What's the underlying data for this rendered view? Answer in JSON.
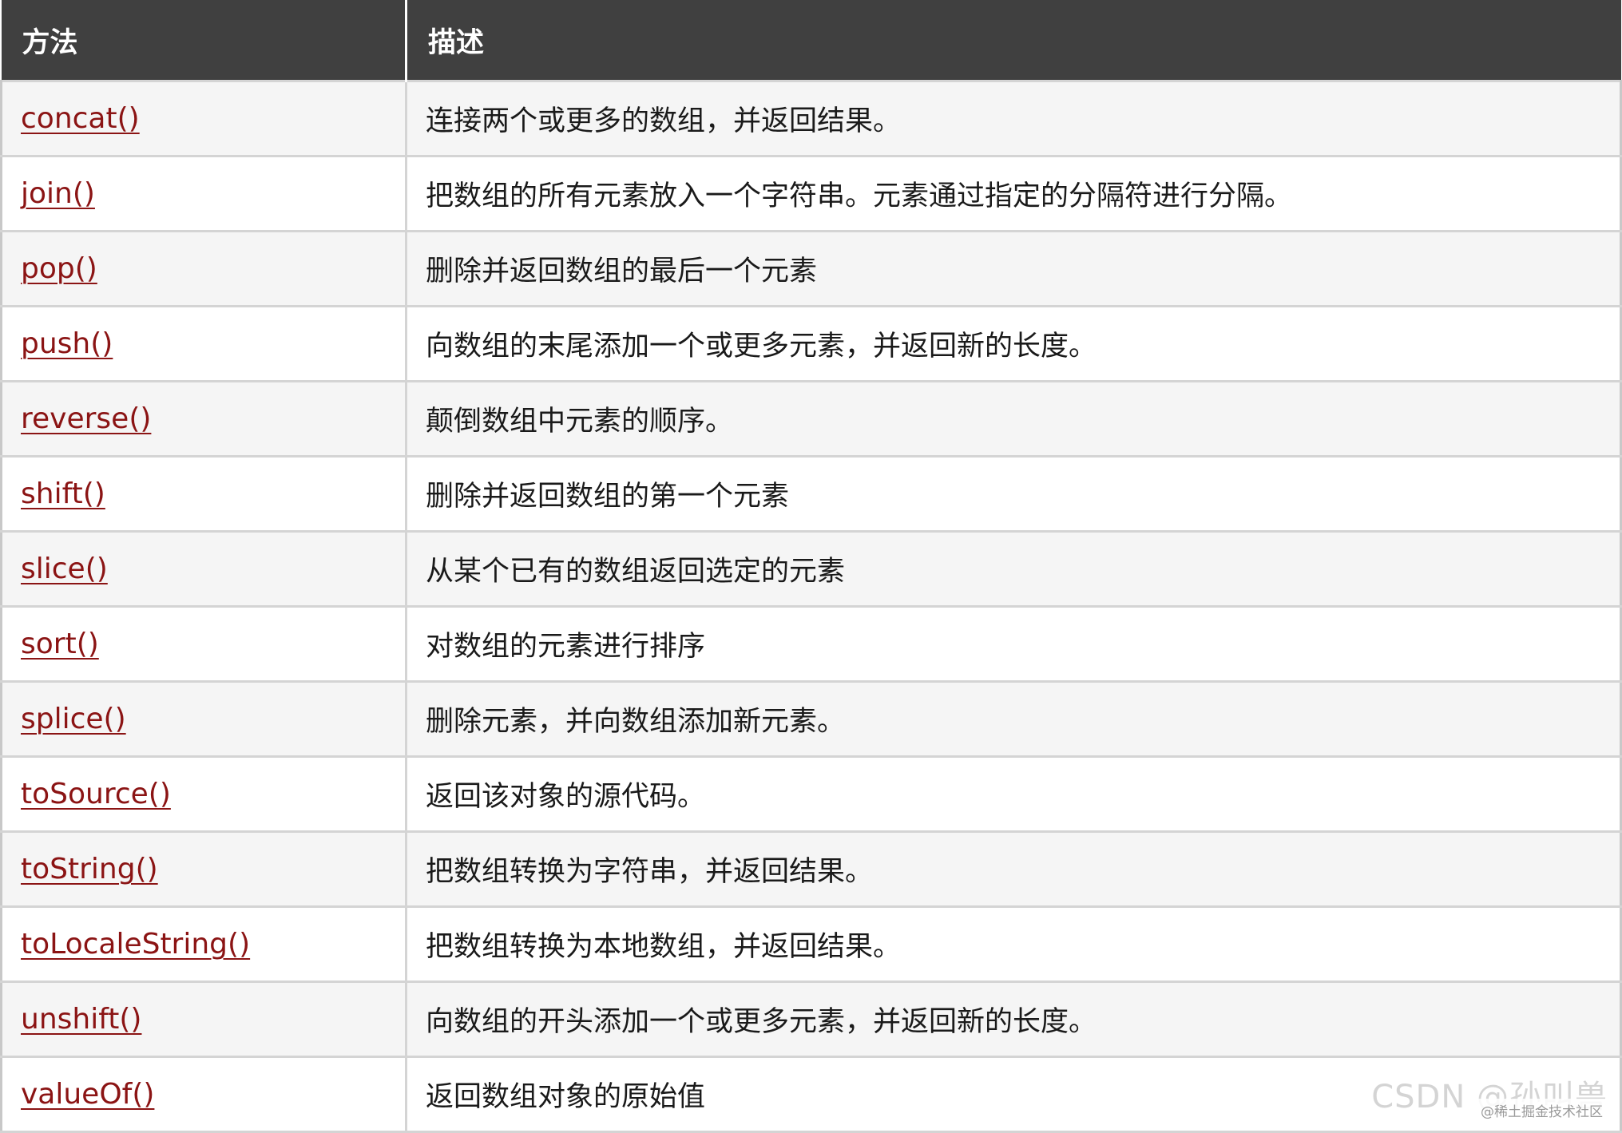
{
  "table": {
    "headers": {
      "method": "方法",
      "description": "描述"
    },
    "rows": [
      {
        "method": "concat()",
        "description": "连接两个或更多的数组，并返回结果。"
      },
      {
        "method": "join()",
        "description": "把数组的所有元素放入一个字符串。元素通过指定的分隔符进行分隔。"
      },
      {
        "method": "pop()",
        "description": "删除并返回数组的最后一个元素"
      },
      {
        "method": "push()",
        "description": "向数组的末尾添加一个或更多元素，并返回新的长度。"
      },
      {
        "method": "reverse()",
        "description": "颠倒数组中元素的顺序。"
      },
      {
        "method": "shift()",
        "description": "删除并返回数组的第一个元素"
      },
      {
        "method": "slice()",
        "description": "从某个已有的数组返回选定的元素"
      },
      {
        "method": "sort()",
        "description": "对数组的元素进行排序"
      },
      {
        "method": "splice()",
        "description": "删除元素，并向数组添加新元素。"
      },
      {
        "method": "toSource()",
        "description": "返回该对象的源代码。"
      },
      {
        "method": "toString()",
        "description": "把数组转换为字符串，并返回结果。"
      },
      {
        "method": "toLocaleString()",
        "description": "把数组转换为本地数组，并返回结果。"
      },
      {
        "method": "unshift()",
        "description": "向数组的开头添加一个或更多元素，并返回新的长度。"
      },
      {
        "method": "valueOf()",
        "description": "返回数组对象的原始值"
      }
    ]
  },
  "watermark": {
    "main": "CSDN @孙叫兽",
    "sub": "@稀土掘金技术社区"
  },
  "colors": {
    "header_bg": "#404040",
    "link": "#8b1414",
    "row_alt": "#f5f5f5"
  }
}
